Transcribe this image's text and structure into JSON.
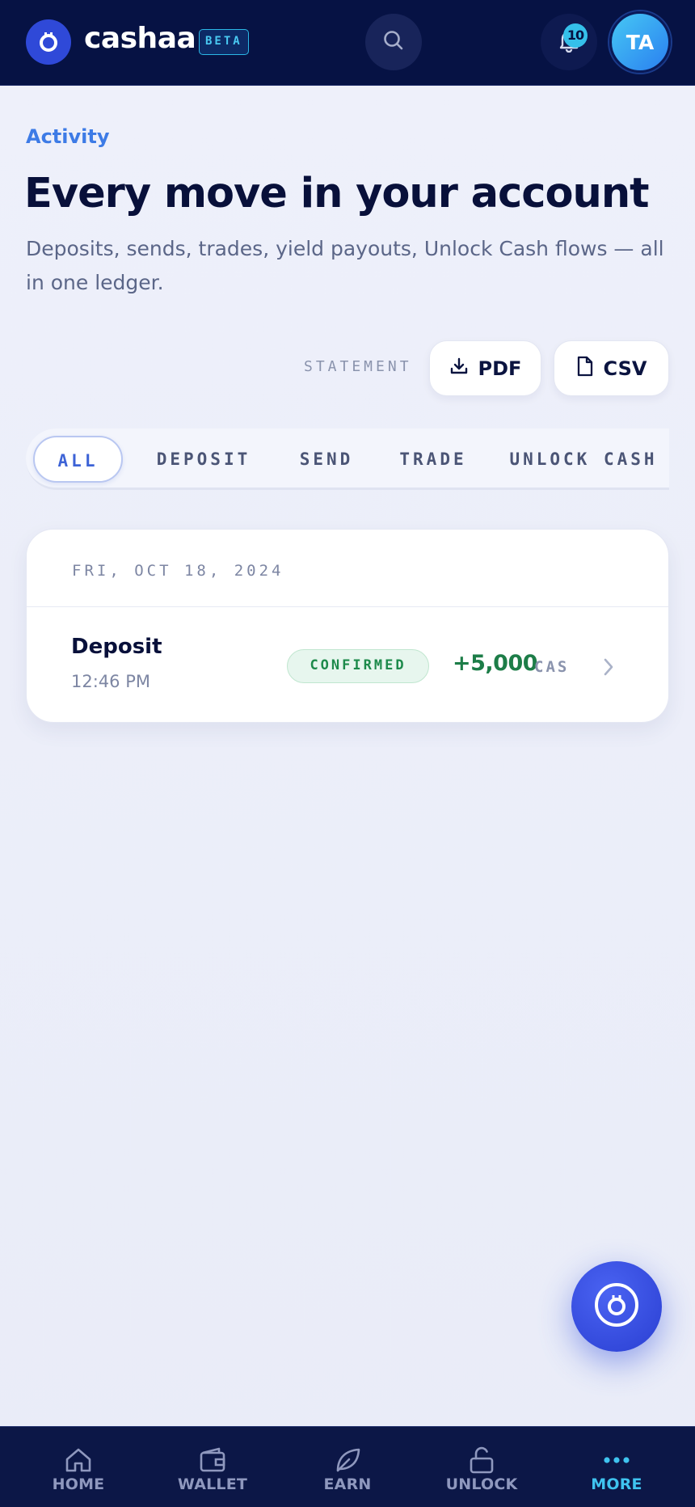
{
  "header": {
    "brand_name": "cashaa",
    "beta_label": "BETA",
    "notification_count": "10",
    "avatar_initials": "TA",
    "icons": [
      "cashaa-logo-icon",
      "search-icon",
      "bell-icon"
    ]
  },
  "intro": {
    "section_label": "Activity",
    "title": "Every move in your account",
    "subtitle": "Deposits, sends, trades, yield payouts, Unlock Cash flows — all in one ledger."
  },
  "statement": {
    "label": "STATEMENT",
    "pdf_label": "PDF",
    "csv_label": "CSV"
  },
  "filters": {
    "selected": "ALL",
    "tabs": [
      "ALL",
      "DEPOSIT",
      "SEND",
      "TRADE",
      "UNLOCK CASH"
    ]
  },
  "activity": {
    "date_header": "FRI, OCT 18, 2024",
    "rows": [
      {
        "title": "Deposit",
        "time": "12:46 PM",
        "status": "CONFIRMED",
        "amount": "+5,000",
        "unit": "CAS"
      }
    ]
  },
  "bottom_nav": {
    "active": "MORE",
    "items": [
      {
        "label": "HOME",
        "icon": "home-icon"
      },
      {
        "label": "WALLET",
        "icon": "wallet-icon"
      },
      {
        "label": "EARN",
        "icon": "leaf-icon"
      },
      {
        "label": "UNLOCK",
        "icon": "unlock-icon"
      },
      {
        "label": "MORE",
        "icon": "more-dots-icon"
      }
    ]
  },
  "colors": {
    "header_bg": "#061244",
    "accent_blue": "#3d7be6",
    "confirmed_green": "#1d8a4b",
    "nav_active": "#3fc3ef"
  }
}
